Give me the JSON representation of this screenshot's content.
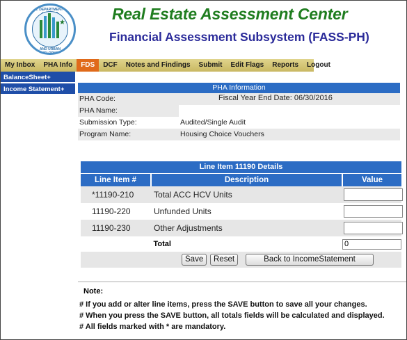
{
  "header": {
    "title": "Real Estate Assessment Center",
    "subtitle": "Financial Assessment Subsystem (FASS-PH)",
    "seal_text_top": "U.S. DEPARTMENT OF HOUSING",
    "seal_text_bottom": "AND URBAN DEVELOPMENT"
  },
  "nav": {
    "items": [
      {
        "label": "My Inbox"
      },
      {
        "label": "PHA Info"
      },
      {
        "label": "FDS"
      },
      {
        "label": "DCF"
      },
      {
        "label": "Notes and Findings"
      },
      {
        "label": "Submit"
      },
      {
        "label": "Edit Flags"
      },
      {
        "label": "Reports"
      },
      {
        "label": "Logout"
      }
    ],
    "active": "FDS"
  },
  "sidebar": {
    "items": [
      {
        "label": "BalanceSheet+"
      },
      {
        "label": "Income Statement+"
      }
    ]
  },
  "pha_info": {
    "heading": "PHA Information",
    "code_label": "PHA Code:",
    "code_value": "",
    "fiscal_year": "Fiscal Year End Date: 06/30/2016",
    "name_label": "PHA Name:",
    "name_value": "",
    "submission_label": "Submission Type:",
    "submission_value": "Audited/Single Audit",
    "program_label": "Program Name:",
    "program_value": "Housing Choice Vouchers"
  },
  "line_item": {
    "title": "Line Item 11190 Details",
    "headers": {
      "line_item": "Line Item #",
      "description": "Description",
      "value": "Value"
    },
    "rows": [
      {
        "code": "*11190-210",
        "description": "Total ACC HCV Units",
        "value": ""
      },
      {
        "code": "11190-220",
        "description": "Unfunded Units",
        "value": ""
      },
      {
        "code": "11190-230",
        "description": "Other Adjustments",
        "value": ""
      }
    ],
    "total_label": "Total",
    "total_value": "0",
    "buttons": {
      "save": "Save",
      "reset": "Reset",
      "back": "Back to IncomeStatement"
    }
  },
  "notes": {
    "title": "Note:",
    "lines": [
      "# If you add or alter line items, press the SAVE button to save all your changes.",
      "# When you press the SAVE button, all totals fields will be calculated and displayed.",
      "# All fields marked with * are mandatory."
    ]
  },
  "colors": {
    "title_green": "#1f7d1f",
    "subtitle_blue": "#2b2b9a",
    "nav_bg": "#d8c97a",
    "nav_active": "#e06a1a",
    "table_header": "#2c6cc4",
    "sidebar_bg": "#1f4ea8"
  }
}
